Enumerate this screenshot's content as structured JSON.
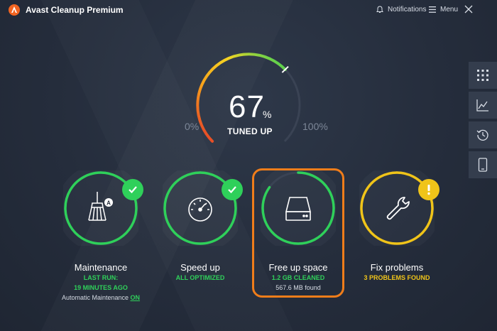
{
  "window": {
    "title": "Avast Cleanup Premium"
  },
  "titlebar": {
    "notifications_label": "Notifications",
    "menu_label": "Menu"
  },
  "gauge": {
    "value": 67,
    "percent_sign": "%",
    "label": "TUNED UP",
    "min_label": "0%",
    "max_label": "100%"
  },
  "sidebar": [
    "grid-icon",
    "chart-icon",
    "history-icon",
    "phone-icon"
  ],
  "cards": [
    {
      "title": "Maintenance",
      "line1": "LAST RUN:",
      "line2": "19 MINUTES AGO",
      "note_prefix": "Automatic Maintenance",
      "note_link": "ON",
      "status": "ok",
      "progress": 1.0,
      "ring_color": "#2fd05a"
    },
    {
      "title": "Speed up",
      "line1": "ALL OPTIMIZED",
      "status": "ok",
      "progress": 1.0,
      "ring_color": "#2fd05a"
    },
    {
      "title": "Free up space",
      "line1": "1.2 GB CLEANED",
      "note": "567.6 MB found",
      "progress": 0.85,
      "ring_color": "#2fd05a",
      "selected": true
    },
    {
      "title": "Fix problems",
      "line1": "3 PROBLEMS FOUND",
      "status": "warning",
      "progress": 1.0,
      "ring_color": "#f0c419"
    }
  ],
  "colors": {
    "accent_green": "#2fd05a",
    "warning_yellow": "#f0c419",
    "highlight_orange": "#f07d1a",
    "avast_orange": "#f26522"
  }
}
